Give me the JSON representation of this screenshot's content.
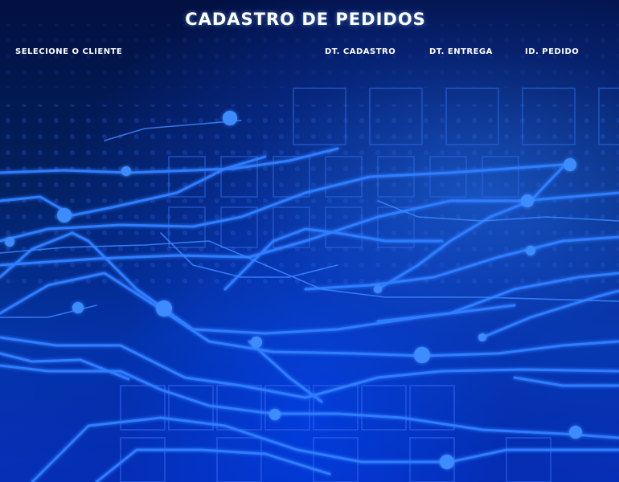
{
  "window": {
    "title": "Cadastro de Pedidos"
  },
  "form": {
    "labels": {
      "cliente": "Selecione o Cliente",
      "dt_cadastro": "Dt. Cadastro",
      "dt_entrega": "Dt. Entrega",
      "id_pedido": "Id. Pedido"
    }
  },
  "theme": {
    "background_dark": "#021042",
    "background_mid": "#0435a8",
    "circuit_line": "#2f7dff",
    "text": "#ffffff"
  }
}
